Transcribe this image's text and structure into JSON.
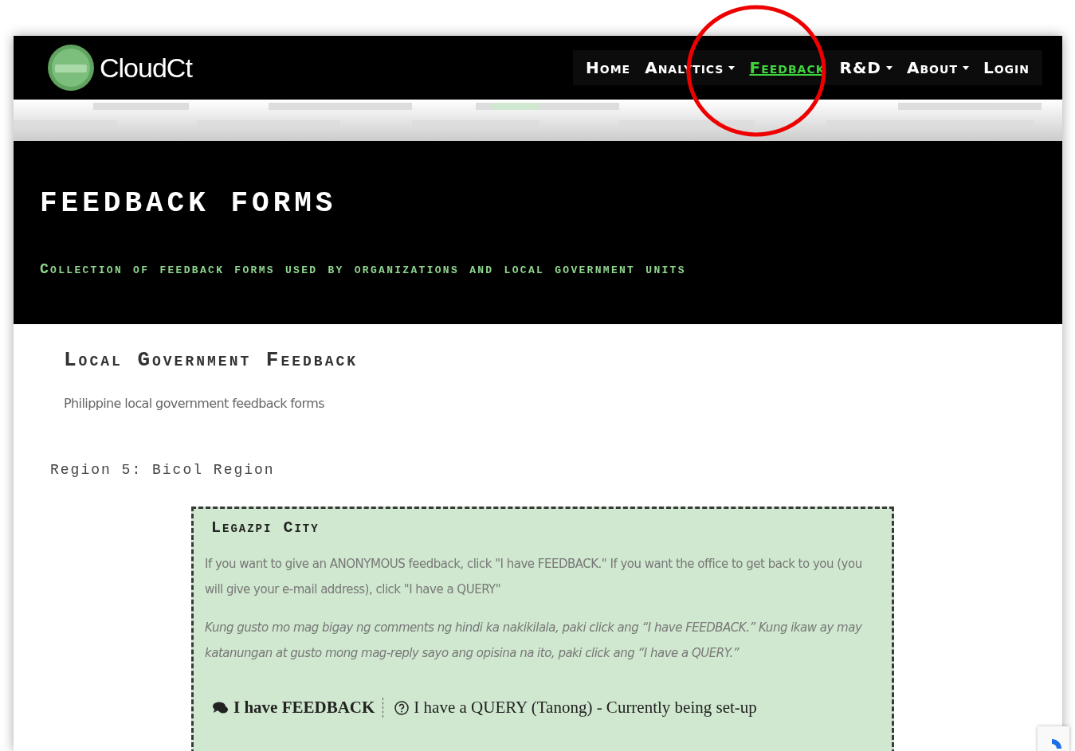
{
  "header": {
    "logo_text": "CloudCt",
    "nav": [
      {
        "label": "Home",
        "selected": false,
        "dropdown": false
      },
      {
        "label": "Analytics",
        "selected": false,
        "dropdown": true
      },
      {
        "label": "Feedback",
        "selected": true,
        "dropdown": false
      },
      {
        "label": "R&D",
        "selected": false,
        "dropdown": true
      },
      {
        "label": "About",
        "selected": false,
        "dropdown": true
      },
      {
        "label": "Login",
        "selected": false,
        "dropdown": false
      }
    ]
  },
  "banner": {
    "title": "FEEDBACK FORMS",
    "subtitle": "Collection of feedback forms used by organizations and local government units"
  },
  "section": {
    "heading": "Local Government Feedback",
    "description": "Philippine local government feedback forms",
    "region": "Region 5: Bicol Region"
  },
  "card": {
    "title": "Legazpi City",
    "text_en": "If you want to give an ANONYMOUS feedback, click \"I have FEEDBACK.\" If you want the office to get back to you (you will give your e-mail address), click \"I have a QUERY\"",
    "text_tl": "Kung gusto mo mag bigay ng comments ng hindi ka nakikilala, paki click ang “I have FEEDBACK.” Kung ikaw ay may katanungan at gusto mong mag-reply sayo ang opisina na ito, paki click ang “I have a QUERY.”",
    "feedback_link": "I have FEEDBACK",
    "query_link": "I have a QUERY (Tanong) - Currently being set-up"
  }
}
